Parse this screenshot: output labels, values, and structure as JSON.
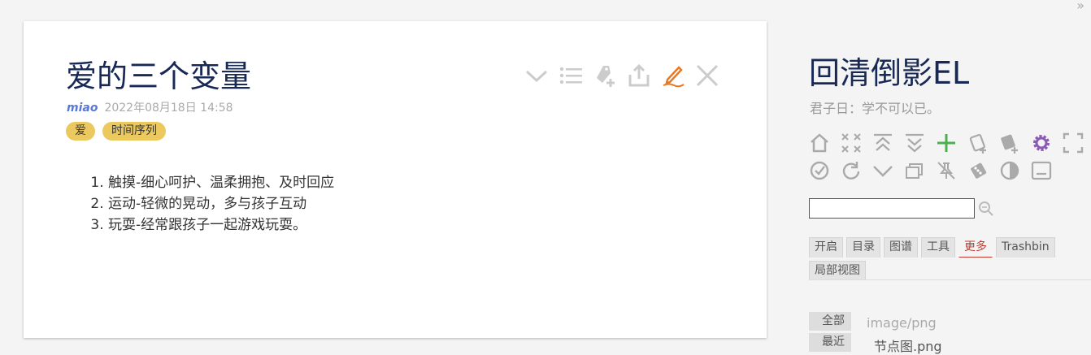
{
  "tiddler": {
    "title": "爱的三个变量",
    "author": "miao",
    "date": "2022年08月18日 14:58",
    "tags": [
      "爱",
      "时间序列"
    ],
    "items": [
      "触摸-细心呵护、温柔拥抱、及时回应",
      "运动-轻微的晃动，多与孩子互动",
      "玩耍-经常跟孩子一起游戏玩耍。"
    ],
    "toolbar": [
      "chevron-down-icon",
      "list-icon",
      "tag-add-icon",
      "export-icon",
      "edit-pencil-icon",
      "close-icon"
    ]
  },
  "sidebar": {
    "expand_label": "»",
    "title": "回清倒影EL",
    "subtitle": "君子日：学不可以已。",
    "controls": [
      "home-icon",
      "close-all-icon",
      "fold-all-icon",
      "unfold-all-icon",
      "new-tiddler-icon",
      "new-journal-icon",
      "new-image-icon",
      "control-panel-icon",
      "fullscreen-icon",
      "save-icon",
      "refresh-icon",
      "chevron-down-icon",
      "layers-icon",
      "unpin-icon",
      "dice-icon",
      "theme-toggle-icon",
      "layout-icon"
    ],
    "search_value": "",
    "tabs": [
      "开启",
      "目录",
      "图谱",
      "工具",
      "更多",
      "Trashbin",
      "局部视图"
    ],
    "active_tab": "更多",
    "subtabs": [
      "全部",
      "最近"
    ],
    "list_type": "image/png",
    "list_item": "节点图.png"
  },
  "colors": {
    "title": "#182955",
    "tag": "#ecc95e",
    "author": "#5778d8",
    "edit_accent": "#e87722",
    "add_accent": "#4caf50",
    "gear_accent": "#8b5ab5",
    "active_tab": "#c0392b"
  }
}
